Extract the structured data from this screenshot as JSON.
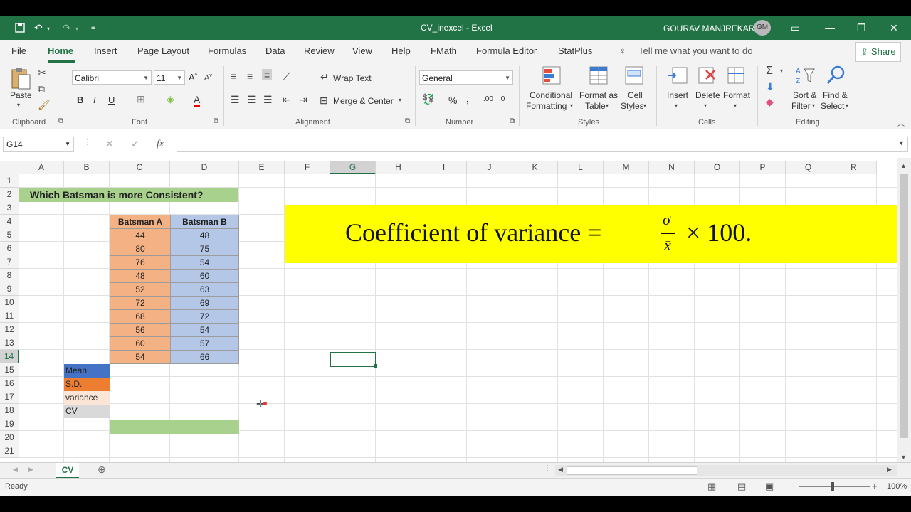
{
  "title_bar": {
    "doc_title": "CV_inexcel  -  Excel",
    "user_name": "GOURAV MANJREKAR",
    "user_initials": "GM"
  },
  "tabs": [
    "File",
    "Home",
    "Insert",
    "Page Layout",
    "Formulas",
    "Data",
    "Review",
    "View",
    "Help",
    "FMath",
    "Formula Editor",
    "StatPlus"
  ],
  "tell_me": "Tell me what you want to do",
  "share": "Share",
  "ribbon": {
    "clipboard": {
      "paste": "Paste",
      "label": "Clipboard"
    },
    "font": {
      "name": "Calibri",
      "size": "11",
      "label": "Font",
      "bold": "B",
      "italic": "I",
      "underline": "U"
    },
    "alignment": {
      "wrap": "Wrap Text",
      "merge": "Merge & Center",
      "label": "Alignment"
    },
    "number": {
      "format": "General",
      "label": "Number",
      "percent": "%"
    },
    "styles": {
      "cond1": "Conditional",
      "cond2": "Formatting",
      "fmt1": "Format as",
      "fmt2": "Table",
      "cell1": "Cell",
      "cell2": "Styles",
      "label": "Styles"
    },
    "cells": {
      "insert": "Insert",
      "delete": "Delete",
      "format": "Format",
      "label": "Cells"
    },
    "editing": {
      "sort1": "Sort &",
      "sort2": "Filter",
      "find1": "Find &",
      "find2": "Select",
      "label": "Editing"
    }
  },
  "formula_bar": {
    "name_box": "G14",
    "fx": "fx",
    "formula": ""
  },
  "columns": [
    "A",
    "B",
    "C",
    "D",
    "E",
    "F",
    "G",
    "H",
    "I",
    "J",
    "K",
    "L",
    "M",
    "N",
    "O",
    "P",
    "Q",
    "R"
  ],
  "rows": [
    "1",
    "2",
    "3",
    "4",
    "5",
    "6",
    "7",
    "8",
    "9",
    "10",
    "11",
    "12",
    "13",
    "14",
    "15",
    "16",
    "17",
    "18",
    "19",
    "20",
    "21"
  ],
  "sheet": {
    "title_cell": "Which Batsman is more Consistent?",
    "header_a": "Batsman A",
    "header_b": "Batsman B",
    "batsman_a": [
      "44",
      "80",
      "76",
      "48",
      "52",
      "72",
      "68",
      "56",
      "60",
      "54"
    ],
    "batsman_b": [
      "48",
      "75",
      "54",
      "60",
      "63",
      "69",
      "72",
      "54",
      "57",
      "66"
    ],
    "labels": {
      "mean": "Mean",
      "sd": "S.D.",
      "variance": "variance",
      "cv": "CV"
    },
    "formula_banner": {
      "text": "Coefficient of variance = ",
      "numerator": "σ",
      "denominator": "x̄",
      "tail": "× 100."
    }
  },
  "sheet_tab": "CV",
  "status": {
    "ready": "Ready",
    "zoom": "100%"
  },
  "colors": {
    "excel_green": "#217346",
    "orange": "#f4b183",
    "blue": "#b4c7e7",
    "title_green": "#a9d18e",
    "banner_yellow": "#ffff00",
    "mean_blue": "#4472c4",
    "sd_orange": "#ed7d31",
    "variance_peach": "#fbe5d6",
    "cv_gray": "#d9d9d9"
  }
}
